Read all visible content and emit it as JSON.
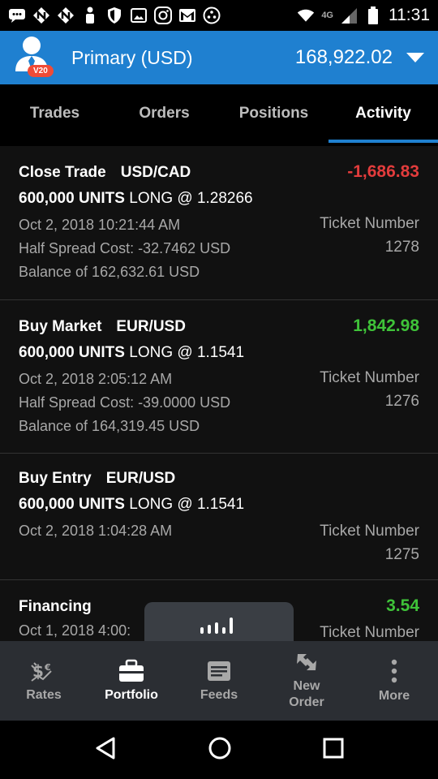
{
  "status": {
    "network": "4G",
    "time": "11:31",
    "icons": [
      "message-icon",
      "notification-n-icon",
      "notification-n-icon",
      "person-icon",
      "shield-icon",
      "image-icon",
      "camera-icon",
      "gmail-icon",
      "dots-icon",
      "wifi-icon",
      "signal-icon",
      "battery-icon"
    ]
  },
  "account": {
    "badge": "V20",
    "name": "Primary (USD)",
    "balance": "168,922.02"
  },
  "tabs": [
    {
      "label": "Trades"
    },
    {
      "label": "Orders"
    },
    {
      "label": "Positions"
    },
    {
      "label": "Activity",
      "active": true
    }
  ],
  "activities": [
    {
      "type": "Close Trade",
      "instrument": "USD/CAD",
      "amount": "-1,686.83",
      "units": "600,000 UNITS",
      "direction": "LONG @ 1.28266",
      "datetime": "Oct 2, 2018 10:21:44 AM",
      "spread": "Half Spread Cost: -32.7462 USD",
      "balance": "Balance of 162,632.61 USD",
      "ticket_label": "Ticket Number",
      "ticket": "1278"
    },
    {
      "type": "Buy Market",
      "instrument": "EUR/USD",
      "amount": "1,842.98",
      "units": "600,000 UNITS",
      "direction": "LONG @ 1.1541",
      "datetime": "Oct 2, 2018 2:05:12 AM",
      "spread": "Half Spread Cost: -39.0000 USD",
      "balance": "Balance of 164,319.45 USD",
      "ticket_label": "Ticket Number",
      "ticket": "1276"
    },
    {
      "type": "Buy Entry",
      "instrument": "EUR/USD",
      "units": "600,000 UNITS",
      "direction": "LONG @ 1.1541",
      "datetime": "Oct 2, 2018 1:04:28 AM",
      "ticket_label": "Ticket Number",
      "ticket": "1275"
    },
    {
      "type": "Financing",
      "amount": "3.54",
      "datetime": "Oct 1, 2018 4:00:",
      "ticket_label": "Ticket Number"
    }
  ],
  "bottom_nav": [
    {
      "label": "Rates",
      "icon": "rates-icon"
    },
    {
      "label": "Portfolio",
      "icon": "briefcase-icon",
      "active": true
    },
    {
      "label": "Feeds",
      "icon": "feeds-icon"
    },
    {
      "label": "New\nOrder",
      "label_line1": "New",
      "label_line2": "Order",
      "icon": "new-order-icon"
    },
    {
      "label": "More",
      "icon": "more-dots-icon"
    }
  ],
  "colors": {
    "accent": "#1f80d0",
    "negative": "#e23c3c",
    "positive": "#3fc339",
    "badge": "#ef4b37"
  }
}
